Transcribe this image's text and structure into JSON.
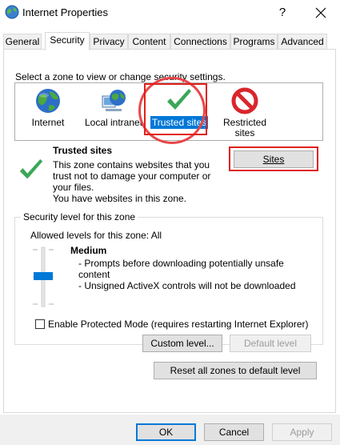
{
  "window": {
    "title": "Internet Properties",
    "help_glyph": "?",
    "icon": "globe-icon"
  },
  "tabs": [
    {
      "label": "General"
    },
    {
      "label": "Security",
      "active": true
    },
    {
      "label": "Privacy"
    },
    {
      "label": "Content"
    },
    {
      "label": "Connections"
    },
    {
      "label": "Programs"
    },
    {
      "label": "Advanced"
    }
  ],
  "security": {
    "select_zone_prompt": "Select a zone to view or change security settings.",
    "zones": [
      {
        "label": "Internet",
        "icon": "globe-icon"
      },
      {
        "label": "Local intranet",
        "icon": "intranet-globe-icon"
      },
      {
        "label": "Trusted sites",
        "icon": "checkmark-icon",
        "selected": true
      },
      {
        "label": "Restricted sites",
        "icon": "no-entry-icon"
      }
    ],
    "zone_info": {
      "title": "Trusted sites",
      "line1": "This zone contains websites that you",
      "line2": "trust not to damage your computer or",
      "line3": "your files.",
      "line4": "You have websites in this zone."
    },
    "sites_button": "Sites",
    "level_group": {
      "legend": "Security level for this zone",
      "allowed": "Allowed levels for this zone: All",
      "level_name": "Medium",
      "bullet1": "- Prompts before downloading potentially unsafe",
      "bullet1b": "content",
      "bullet2": "- Unsigned ActiveX controls will not be downloaded",
      "slider_level": "Medium"
    },
    "protected_mode": {
      "label": "Enable Protected Mode (requires restarting Internet Explorer)",
      "checked": false
    },
    "custom_level_button": "Custom level...",
    "default_level_button": "Default level",
    "reset_button": "Reset all zones to default level"
  },
  "footer": {
    "ok": "OK",
    "cancel": "Cancel",
    "apply": "Apply"
  },
  "colors": {
    "accent": "#0078d7",
    "highlight_red": "#e0201b",
    "check_green": "#3aa757"
  }
}
